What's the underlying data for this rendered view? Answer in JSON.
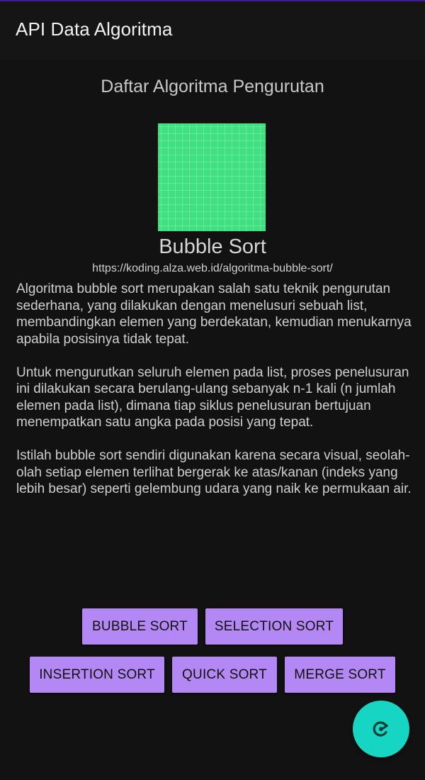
{
  "app": {
    "title": "API Data Algoritma"
  },
  "main": {
    "section_title": "Daftar Algoritma Pengurutan",
    "selected": {
      "name": "Bubble Sort",
      "url": "https://koding.alza.web.id/algoritma-bubble-sort/",
      "paragraphs": [
        "Algoritma bubble sort merupakan salah satu teknik pengurutan sederhana, yang dilakukan dengan menelusuri sebuah list, membandingkan elemen yang berdekatan, kemudian menukarnya apabila posisinya tidak tepat.",
        "Untuk mengurutkan seluruh elemen pada list, proses penelusuran ini dilakukan secara berulang-ulang sebanyak n-1 kali (n jumlah elemen pada list), dimana tiap siklus penelusuran bertujuan menempatkan satu angka pada posisi yang tepat.",
        "Istilah bubble sort sendiri digunakan karena secara visual, seolah-olah setiap elemen terlihat bergerak ke atas/kanan (indeks yang lebih besar) seperti gelembung udara yang naik ke permukaan air."
      ]
    }
  },
  "buttons": {
    "bubble": "BUBBLE SORT",
    "selection": "SELECTION SORT",
    "insertion": "INSERTION SORT",
    "quick": "QUICK SORT",
    "merge": "MERGE SORT"
  },
  "fab": {
    "icon": "refresh-icon"
  },
  "colors": {
    "background": "#121212",
    "button": "#b388f5",
    "fab": "#16d6c3",
    "thumbnail": "#3ee07f"
  }
}
